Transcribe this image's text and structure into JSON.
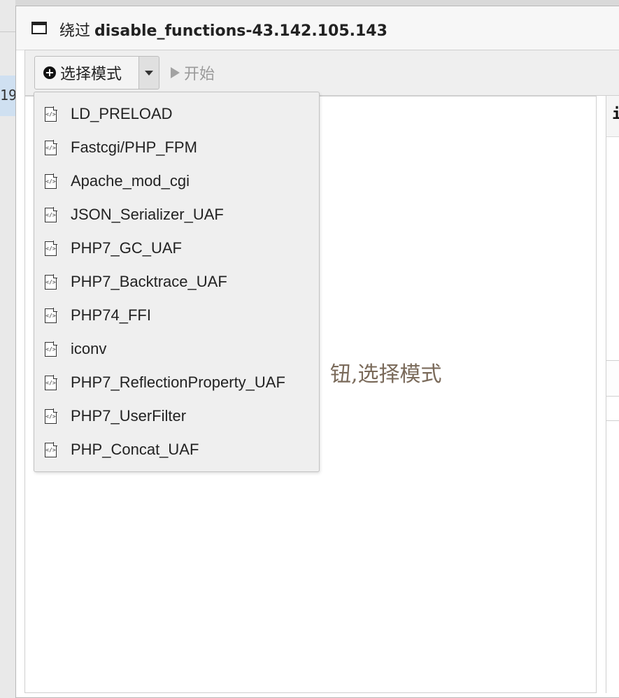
{
  "background": {
    "cell_text": "19"
  },
  "window": {
    "title_prefix": "绕过",
    "title_host": "disable_functions-43.142.105.143"
  },
  "toolbar": {
    "select_mode_label": "选择模式",
    "start_label": "开始"
  },
  "main": {
    "hint": "钮,选择模式"
  },
  "right_panel": {
    "header_text": "i"
  },
  "dropdown": {
    "items": [
      {
        "label": "LD_PRELOAD",
        "icon": "code-file-icon"
      },
      {
        "label": "Fastcgi/PHP_FPM",
        "icon": "code-file-icon"
      },
      {
        "label": "Apache_mod_cgi",
        "icon": "code-file-icon"
      },
      {
        "label": "JSON_Serializer_UAF",
        "icon": "code-file-icon"
      },
      {
        "label": "PHP7_GC_UAF",
        "icon": "code-file-icon"
      },
      {
        "label": "PHP7_Backtrace_UAF",
        "icon": "code-file-icon"
      },
      {
        "label": "PHP74_FFI",
        "icon": "code-file-icon"
      },
      {
        "label": "iconv",
        "icon": "code-file-icon"
      },
      {
        "label": "PHP7_ReflectionProperty_UAF",
        "icon": "code-file-icon"
      },
      {
        "label": "PHP7_UserFilter",
        "icon": "code-file-icon"
      },
      {
        "label": "PHP_Concat_UAF",
        "icon": "code-file-icon"
      }
    ]
  }
}
